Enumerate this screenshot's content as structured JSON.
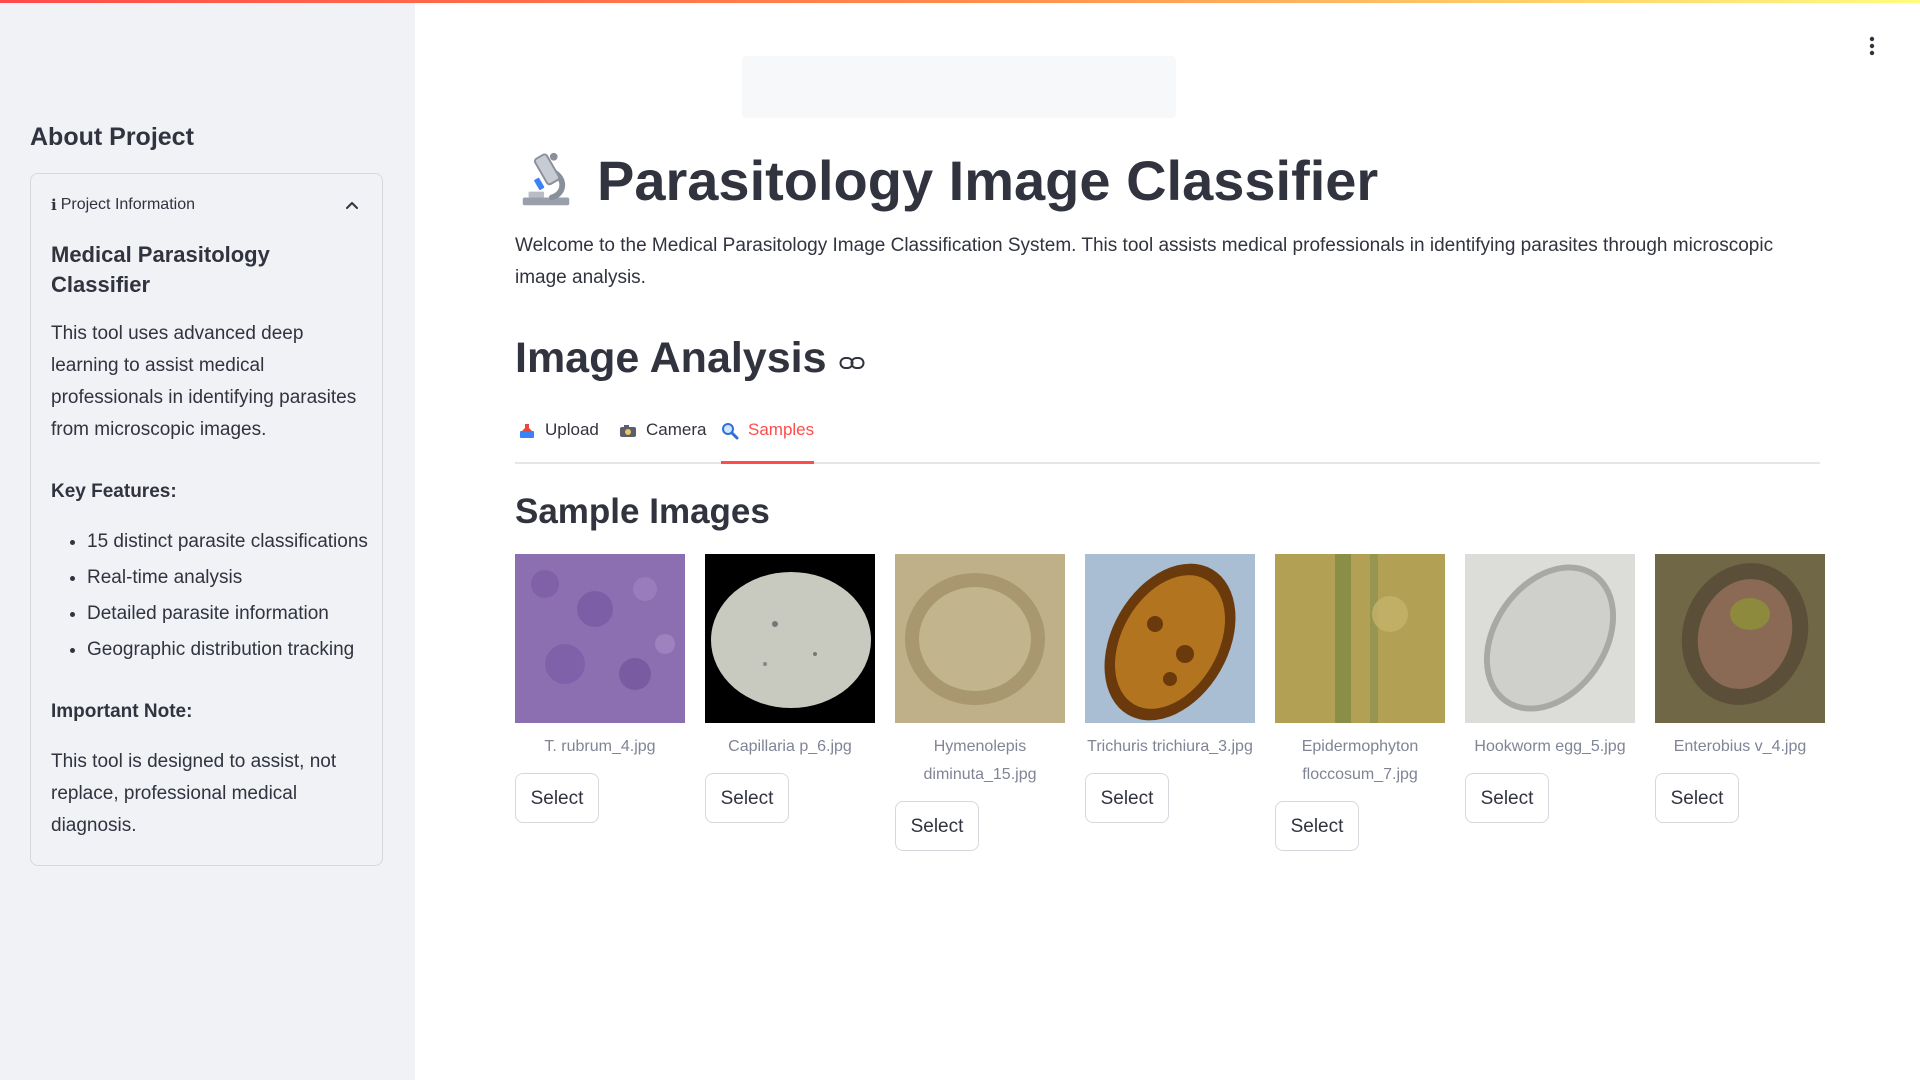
{
  "sidebar": {
    "title": "About Project",
    "expander": {
      "header": "Project Information",
      "info_glyph": "i",
      "heading": "Medical Parasitology Classifier",
      "description": "This tool uses advanced deep learning to assist medical professionals in identifying parasites from microscopic images.",
      "features_label": "Key Features:",
      "features": [
        "15 distinct parasite classifications",
        "Real-time analysis",
        "Detailed parasite information",
        "Geographic distribution tracking"
      ],
      "note_label": "Important Note:",
      "note": "This tool is designed to assist, not replace, professional medical diagnosis."
    }
  },
  "main": {
    "title": "Parasitology Image Classifier",
    "intro": "Welcome to the Medical Parasitology Image Classification System. This tool assists medical professionals in identifying parasites through microscopic image analysis.",
    "section_title": "Image Analysis",
    "tabs": [
      {
        "label": "Upload",
        "icon": "inbox-tray-icon"
      },
      {
        "label": "Camera",
        "icon": "camera-icon"
      },
      {
        "label": "Samples",
        "icon": "magnifier-icon",
        "active": true
      }
    ],
    "samples_title": "Sample Images",
    "samples": [
      {
        "caption": "T. rubrum_4.jpg",
        "button": "Select"
      },
      {
        "caption": "Capillaria p_6.jpg",
        "button": "Select"
      },
      {
        "caption": "Hymenolepis diminuta_15.jpg",
        "button": "Select"
      },
      {
        "caption": "Trichuris trichiura_3.jpg",
        "button": "Select"
      },
      {
        "caption": "Epidermophyton floccosum_7.jpg",
        "button": "Select"
      },
      {
        "caption": "Hookworm egg_5.jpg",
        "button": "Select"
      },
      {
        "caption": "Enterobius v_4.jpg",
        "button": "Select"
      }
    ]
  },
  "colors": {
    "accent": "#ff4b4b",
    "sidebar_bg": "#f0f2f6",
    "text": "#31333f",
    "caption": "#808495"
  }
}
